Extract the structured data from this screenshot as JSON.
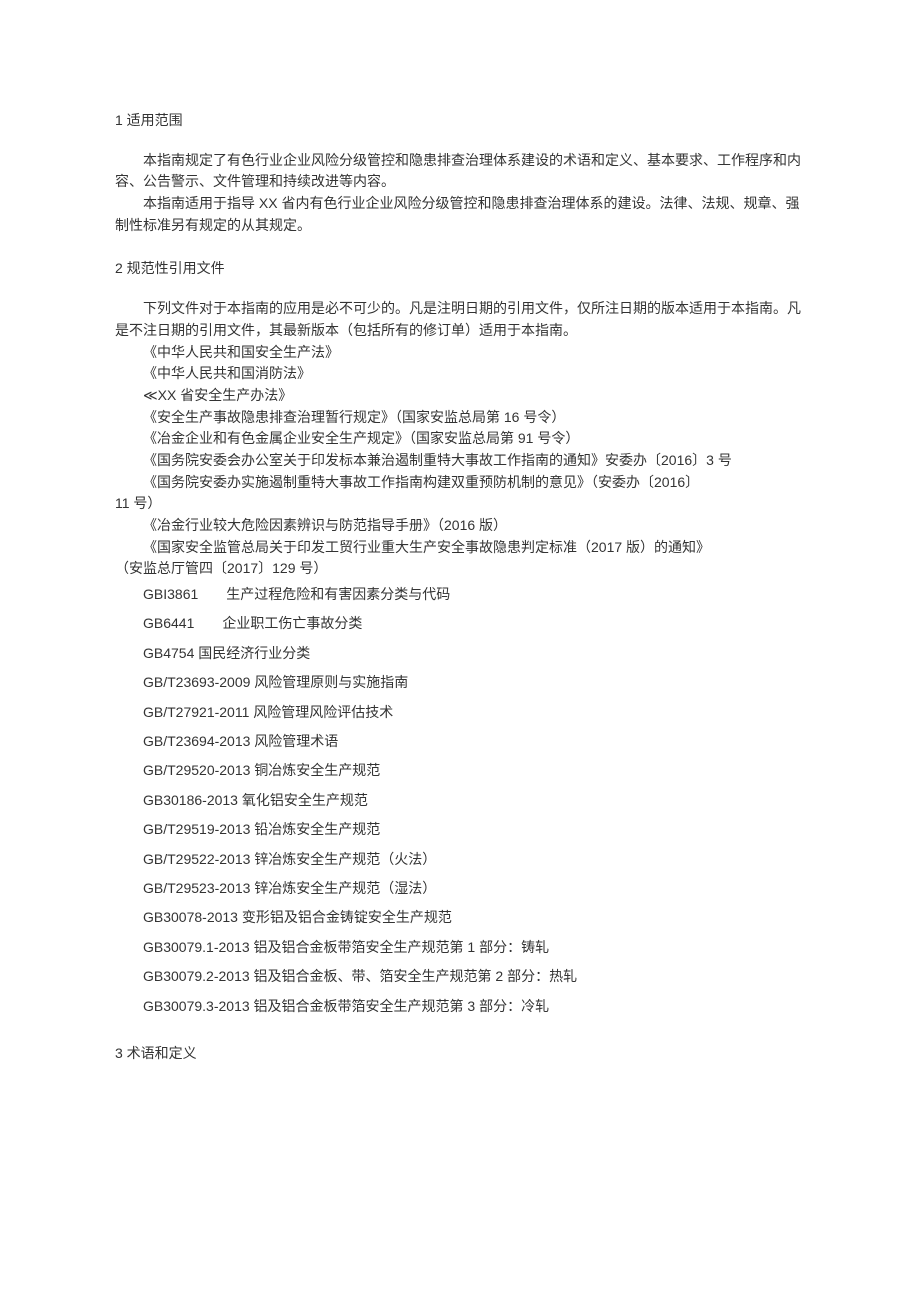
{
  "sections": {
    "s1": {
      "title": "1 适用范围",
      "p1": "本指南规定了有色行业企业风险分级管控和隐患排查治理体系建设的术语和定义、基本要求、工作程序和内容、公告警示、文件管理和持续改进等内容。",
      "p2": "本指南适用于指导 XX 省内有色行业企业风险分级管控和隐患排查治理体系的建设。法律、法规、规章、强制性标准另有规定的从其规定。"
    },
    "s2": {
      "title": "2 规范性引用文件",
      "p1": "下列文件对于本指南的应用是必不可少的。凡是注明日期的引用文件，仅所注日期的版本适用于本指南。凡是不注日期的引用文件，其最新版本（包括所有的修订单）适用于本指南。",
      "refs": [
        "《中华人民共和国安全生产法》",
        "《中华人民共和国消防法》",
        "≪XX 省安全生产办法》",
        "《安全生产事故隐患排查治理暂行规定》（国家安监总局第 16 号令）",
        "《冶金企业和有色金属企业安全生产规定》（国家安监总局第 91 号令）",
        "《国务院安委会办公室关于印发标本兼治遏制重特大事故工作指南的通知》安委办〔2016〕3 号"
      ],
      "ref_wrap_a": "《国务院安委办实施遏制重特大事故工作指南构建双重预防机制的意见》（安委办〔2016〕",
      "ref_wrap_b": "11 号）",
      "refs2": [
        "《冶金行业较大危险因素辨识与防范指导手册》（2016 版）"
      ],
      "ref_wrap2_a": "《国家安全监管总局关于印发工贸行业重大生产安全事故隐患判定标准（2017 版）的通知》",
      "ref_wrap2_b": "（安监总厅管四〔2017〕129 号）",
      "standards": [
        "GBI3861　　生产过程危险和有害因素分类与代码",
        "GB6441　　企业职工伤亡事故分类",
        "GB4754 国民经济行业分类",
        "GB/T23693-2009 风险管理原则与实施指南",
        "GB/T27921-2011 风险管理风险评估技术",
        "GB/T23694-2013 风险管理术语",
        "GB/T29520-2013 铜冶炼安全生产规范",
        "GB30186-2013 氧化铝安全生产规范",
        "GB/T29519-2013 铅冶炼安全生产规范",
        "GB/T29522-2013 锌冶炼安全生产规范（火法）",
        "GB/T29523-2013 锌冶炼安全生产规范（湿法）",
        "GB30078-2013 变形铝及铝合金铸锭安全生产规范",
        "GB30079.1-2013 铝及铝合金板带箔安全生产规范第 1 部分：铸轧",
        "GB30079.2-2013 铝及铝合金板、带、箔安全生产规范第 2 部分：热轧",
        "GB30079.3-2013 铝及铝合金板带箔安全生产规范第 3 部分：冷轧"
      ]
    },
    "s3": {
      "title": "3 术语和定义"
    }
  }
}
